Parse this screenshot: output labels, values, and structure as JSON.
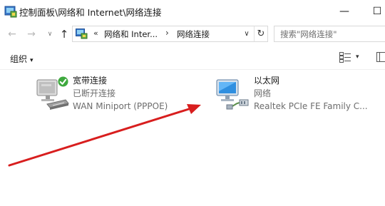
{
  "window": {
    "title": "控制面板\\网络和 Internet\\网络连接",
    "minimize_glyph": "—",
    "maximize_glyph": "☐"
  },
  "nav": {
    "back_glyph": "←",
    "forward_glyph": "→",
    "recent_glyph": "∨",
    "up_glyph": "↑"
  },
  "address": {
    "overflow": "«",
    "segments": [
      "网络和 Inter...",
      "网络连接"
    ],
    "separator": "›",
    "dropdown_glyph": "∨",
    "refresh_glyph": "↻"
  },
  "search": {
    "placeholder": "搜索\"网络连接\""
  },
  "toolbar": {
    "organize_label": "组织",
    "organize_caret": "▾",
    "view_caret": "▾"
  },
  "connections": [
    {
      "name": "宽带连接",
      "status": "已断开连接",
      "device": "WAN Miniport (PPPOE)",
      "icon": "dialup-connection-icon",
      "overlay": "connected-check-icon"
    },
    {
      "name": "以太网",
      "status": "网络",
      "device": "Realtek PCIe FE Family C...",
      "icon": "ethernet-connection-icon"
    }
  ],
  "annotation": {
    "arrow_color": "#d81e1e"
  }
}
